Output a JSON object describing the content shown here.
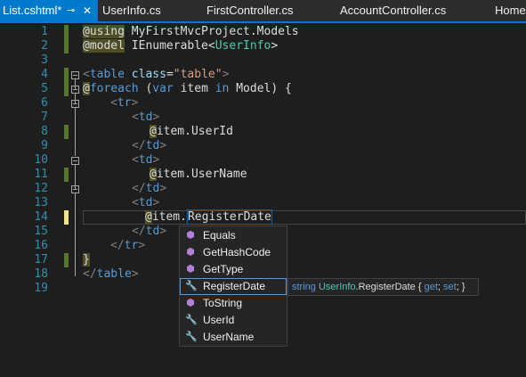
{
  "tabs": [
    {
      "label": "List.cshtml*"
    },
    {
      "label": "UserInfo.cs"
    },
    {
      "label": "FirstController.cs"
    },
    {
      "label": "AccountController.cs"
    },
    {
      "label": "HomeC"
    }
  ],
  "tab_icons": {
    "pin": "⊸",
    "close": "✕"
  },
  "line_numbers": [
    "1",
    "2",
    "3",
    "4",
    "5",
    "6",
    "7",
    "8",
    "9",
    "10",
    "11",
    "12",
    "13",
    "14",
    "15",
    "16",
    "17",
    "18",
    "19"
  ],
  "code": {
    "l1a": "@",
    "l1b": "using",
    "l1c": " MyFirstMvcProject.Models",
    "l2a": "@",
    "l2b": "model",
    "l2c": " IEnumerable<",
    "l2d": "UserInfo",
    "l2e": ">",
    "l4a": "<",
    "l4b": "table",
    "l4c": " class",
    "l4d": "=",
    "l4e": "\"table\"",
    "l4f": ">",
    "l5a": "@",
    "l5b": "foreach",
    "l5c": " (",
    "l5d": "var",
    "l5e": " item ",
    "l5f": "in",
    "l5g": " Model) {",
    "l6a": "<",
    "l6b": "tr",
    "l6c": ">",
    "l7a": "<",
    "l7b": "td",
    "l7c": ">",
    "l8a": "@",
    "l8b": "item.UserId",
    "l9a": "</",
    "l9b": "td",
    "l9c": ">",
    "l10a": "<",
    "l10b": "td",
    "l10c": ">",
    "l11a": "@",
    "l11b": "item.UserName",
    "l12a": "</",
    "l12b": "td",
    "l12c": ">",
    "l13a": "<",
    "l13b": "td",
    "l13c": ">",
    "l14a": "@",
    "l14b": "item.",
    "l14c": "RegisterDate",
    "l15a": "</",
    "l15b": "td",
    "l15c": ">",
    "l16a": "</",
    "l16b": "tr",
    "l16c": ">",
    "l17a": "}",
    "l18a": "</",
    "l18b": "table",
    "l18c": ">"
  },
  "completion": {
    "items": [
      {
        "label": "Equals",
        "icon": "method-cube-icon"
      },
      {
        "label": "GetHashCode",
        "icon": "method-cube-icon"
      },
      {
        "label": "GetType",
        "icon": "method-cube-icon"
      },
      {
        "label": "RegisterDate",
        "icon": "property-wrench-icon"
      },
      {
        "label": "ToString",
        "icon": "method-cube-icon"
      },
      {
        "label": "UserId",
        "icon": "property-wrench-icon"
      },
      {
        "label": "UserName",
        "icon": "property-wrench-icon"
      }
    ],
    "selected_index": 3,
    "tooltip": {
      "a": "string ",
      "b": "UserInfo",
      "c": ".RegisterDate { ",
      "d": "get",
      "e": "; ",
      "f": "set",
      "g": "; }"
    }
  },
  "colors": {
    "accent": "#007acc",
    "background": "#1e1e1e",
    "line_number": "#2b91af",
    "keyword": "#569cd6"
  }
}
